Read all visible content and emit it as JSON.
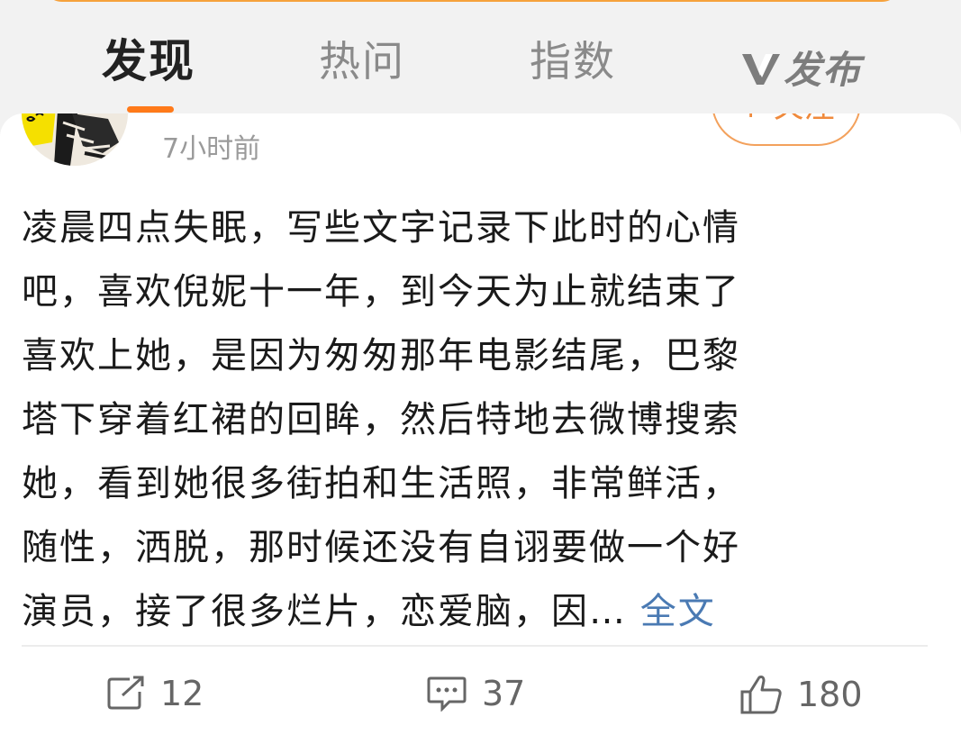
{
  "tabs": [
    {
      "label": "发现",
      "active": true
    },
    {
      "label": "热问",
      "active": false
    },
    {
      "label": "指数",
      "active": false
    },
    {
      "label": "发布",
      "active": false
    }
  ],
  "post": {
    "timestamp": "7小时前",
    "follow_label": "+ 关注",
    "lines": [
      "凌晨四点失眠，写些文字记录下此时的心情",
      "吧，喜欢倪妮十一年，到今天为止就结束了",
      "喜欢上她，是因为匆匆那年电影结尾，巴黎",
      "塔下穿着红裙的回眸，然后特地去微博搜索",
      "她，看到她很多街拍和生活照，非常鲜活，",
      "随性，洒脱，那时候还没有自诩要做一个好"
    ],
    "last_line": "演员，接了很多烂片，恋爱脑，因…",
    "read_more": "全文"
  },
  "actions": {
    "repost_count": "12",
    "comment_count": "37",
    "like_count": "180"
  },
  "colors": {
    "accent_orange": "#ff7a1a",
    "link_blue": "#4a7ab3"
  }
}
